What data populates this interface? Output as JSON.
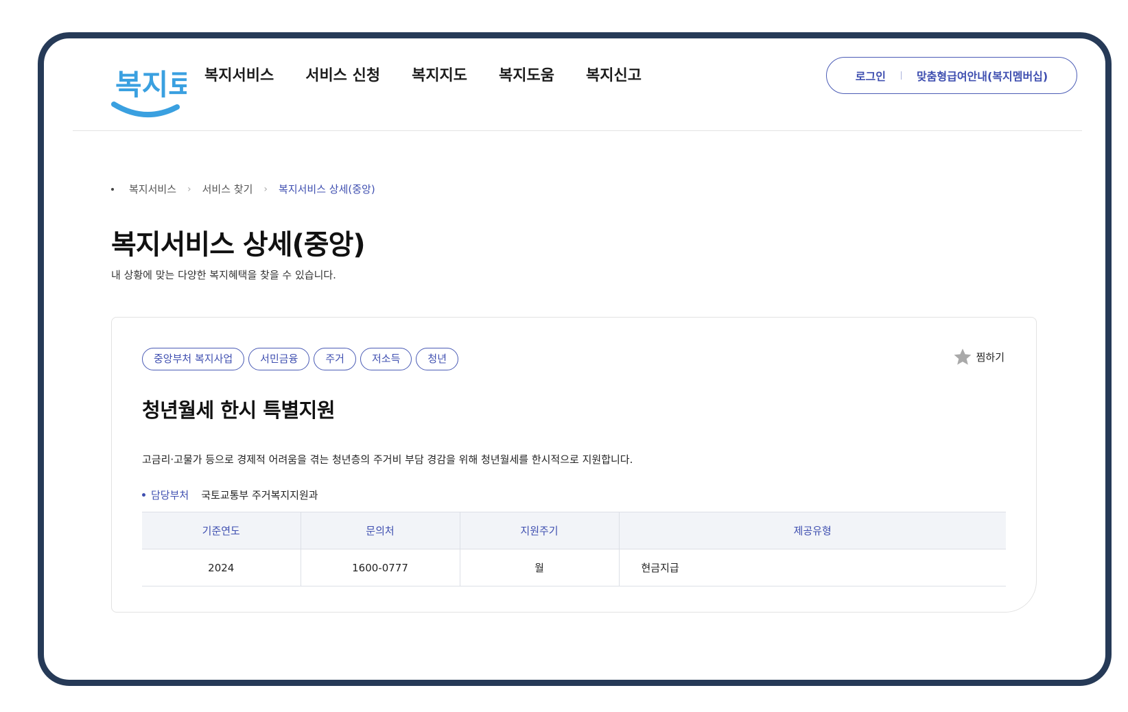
{
  "header": {
    "logo_text": "복지로",
    "nav": [
      "복지서비스",
      "서비스 신청",
      "복지지도",
      "복지도움",
      "복지신고"
    ],
    "util": {
      "login": "로그인",
      "membership": "맞춤형급여안내(복지멤버십)"
    }
  },
  "breadcrumb": {
    "items": [
      "복지서비스",
      "서비스 찾기"
    ],
    "current": "복지서비스 상세(중앙)"
  },
  "page": {
    "title": "복지서비스 상세(중앙)",
    "description": "내 상황에 맞는 다양한 복지혜택을 찾을 수 있습니다."
  },
  "service": {
    "tags": [
      "중앙부처 복지사업",
      "서민금융",
      "주거",
      "저소득",
      "청년"
    ],
    "bookmark_label": "찜하기",
    "title": "청년월세 한시 특별지원",
    "description": "고금리·고물가 등으로 경제적 어려움을 겪는 청년층의 주거비 부담 경감을 위해 청년월세를 한시적으로 지원합니다.",
    "department_label": "담당부처",
    "department_value": "국토교통부 주거복지지원과",
    "table": {
      "headers": [
        "기준연도",
        "문의처",
        "지원주기",
        "제공유형"
      ],
      "row": [
        "2024",
        "1600-0777",
        "월",
        "현금지급"
      ]
    }
  },
  "colors": {
    "frame": "#263a57",
    "accent": "#3f4fb0",
    "logo_blue": "#3aa0e0"
  }
}
